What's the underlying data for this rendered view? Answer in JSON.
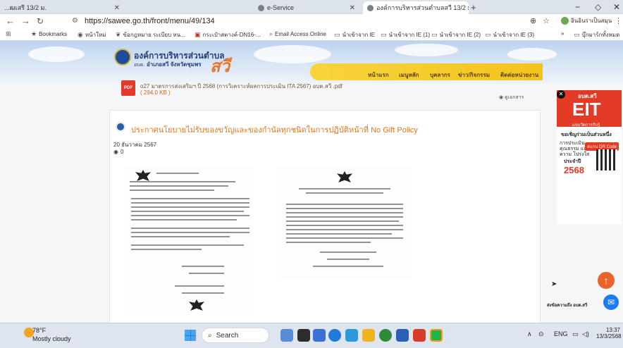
{
  "tabs": [
    {
      "title": "...ฒเสรี 13/2 ม.",
      "active": false
    },
    {
      "title": "e-Service",
      "active": false
    },
    {
      "title": "องค์การบริหารส่วนตำบลสวี 13/2 ม.",
      "active": true
    }
  ],
  "window": {
    "minimize": "−",
    "restore": "◇",
    "close": "✕",
    "new_tab": "+"
  },
  "address": {
    "url": "https://sawee.go.th/front/menu/49/134"
  },
  "bookmarks": [
    {
      "label": "Bookmarks",
      "icon": "star-icon"
    },
    {
      "label": "หน้าใหม่",
      "icon": "chrome-icon"
    },
    {
      "label": "ข้อกฎหมาย ระเบียบ หน...",
      "icon": "leaf-icon"
    },
    {
      "label": "กระเป๋าสตางค์-DN16-...",
      "icon": "pdf-icon"
    },
    {
      "label": "Email Access Online",
      "icon": "search-icon"
    },
    {
      "label": "นำเข้าจาก IE",
      "icon": "folder-icon"
    },
    {
      "label": "นำเข้าจาก IE (1)",
      "icon": "folder-icon"
    },
    {
      "label": "นำเข้าจาก IE (2)",
      "icon": "folder-icon"
    },
    {
      "label": "นำเข้าจาก IE (3)",
      "icon": "folder-icon"
    }
  ],
  "bookmarks_more": "»",
  "bookmarks_all": "บุ๊กมาร์กทั้งหมด",
  "profile_label": "อินอินร่าเป็นสมุน",
  "site": {
    "org_name": "องค์การบริหารส่วนตำบล",
    "org_short": "สวี",
    "district": "อำเภอสวี จังหวัดชุมพร",
    "abbr": "อบต.",
    "menu": [
      "หน้าแรก",
      "เมนูหลัก",
      "บุคลากร",
      "ข่าว/กิจกรรม",
      "ติดต่อหน่วยงาน"
    ]
  },
  "attachment": {
    "icon_label": "PDF",
    "name": "o27 มาตรการส่งเสริมฯ ปี 2568 (การวิเคราะห์ผลการประเมิน ITA 2567) อบต.สวี .pdf",
    "size": "( 294.0 KB )",
    "view_label": "ดูเอกสาร"
  },
  "post": {
    "title": "ประกาศนโยบายไม่รับของขวัญและของกำนัลทุกชนิดในการปฏิบัติหน้าที่ No Gift Policy",
    "date": "20 ธันวาคม 2567",
    "views": "0"
  },
  "eit_banner": {
    "tag": "อบต.สวี",
    "big": "EIT",
    "sub": "แบบวัดการรับรู้",
    "invite": "ขอเชิญร่วมเป็นส่วนหนึ่ง",
    "body": "การประเมิน คุณธรรม และความ โปร่งใส",
    "button": "สแกน QR Code",
    "year_label": "ประจำปี",
    "year": "2568"
  },
  "contact_label": "ส่งข้อความถึง อบต.สวี",
  "taskbar": {
    "temp": "78°F",
    "condition": "Mostly cloudy",
    "search_placeholder": "Search",
    "lang": "ENG",
    "time": "13:37",
    "date": "13/3/2568"
  },
  "colors": {
    "accent_orange": "#e2761b",
    "menu_yellow": "#f5c21d",
    "eit_red": "#e33a26",
    "logo_blue": "#24407e"
  }
}
